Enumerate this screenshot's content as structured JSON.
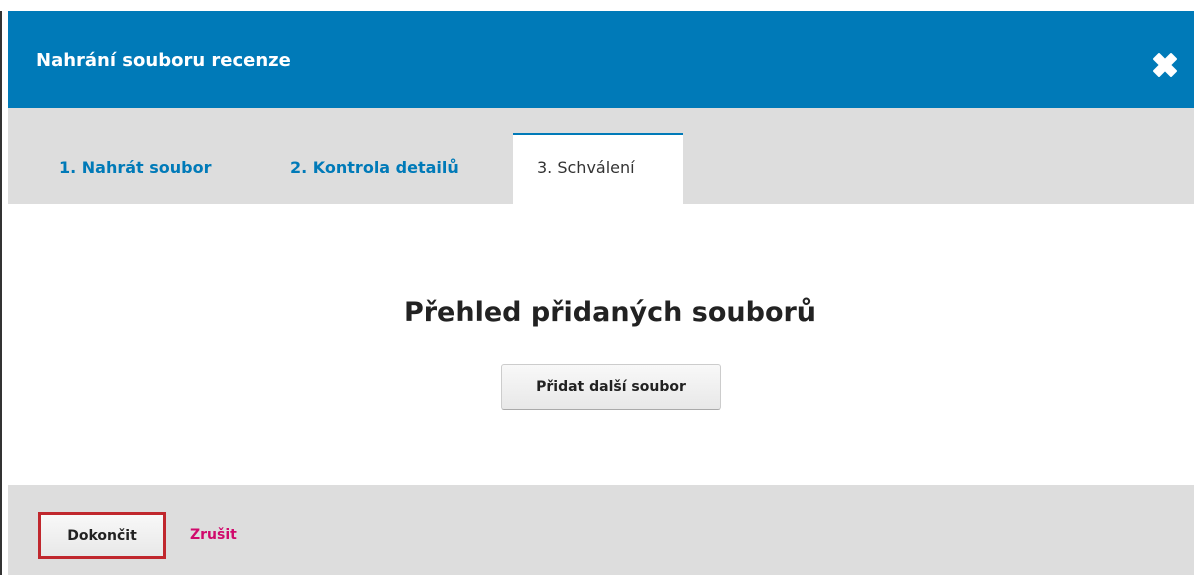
{
  "modal": {
    "title": "Nahrání souboru recenze",
    "close_icon": "close-icon"
  },
  "tabs": [
    {
      "label": "1. Nahrát soubor",
      "active": false
    },
    {
      "label": "2. Kontrola detailů",
      "active": false
    },
    {
      "label": "3. Schválení",
      "active": true
    }
  ],
  "content": {
    "heading": "Přehled přidaných souborů",
    "add_file_label": "Přidat další soubor"
  },
  "footer": {
    "finish_label": "Dokončit",
    "cancel_label": "Zrušit"
  },
  "colors": {
    "header": "#007ab8",
    "tab_bar": "#dddddd",
    "cancel": "#d00a6c",
    "highlight": "#c0272d"
  }
}
